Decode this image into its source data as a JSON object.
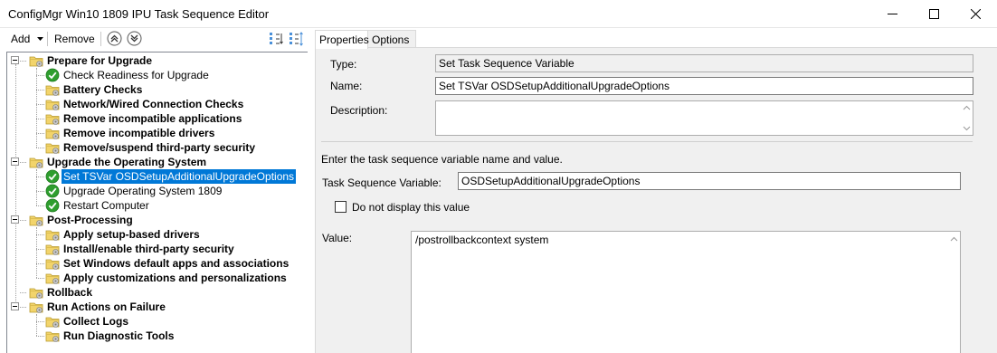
{
  "window": {
    "title": "ConfigMgr Win10 1809 IPU Task Sequence Editor",
    "controls": [
      "minimize-icon",
      "maximize-icon",
      "close-icon"
    ]
  },
  "toolbar": {
    "add_label": "Add",
    "remove_label": "Remove"
  },
  "tree": {
    "items": [
      {
        "label": "Prepare for Upgrade",
        "bold": true,
        "level": 0,
        "icon": "folder-icon"
      },
      {
        "label": "Check Readiness for Upgrade",
        "bold": false,
        "level": 1,
        "icon": "check-icon"
      },
      {
        "label": "Battery Checks",
        "bold": true,
        "level": 1,
        "icon": "folder-icon"
      },
      {
        "label": "Network/Wired Connection Checks",
        "bold": true,
        "level": 1,
        "icon": "folder-icon"
      },
      {
        "label": "Remove incompatible applications",
        "bold": true,
        "level": 1,
        "icon": "folder-icon"
      },
      {
        "label": "Remove incompatible drivers",
        "bold": true,
        "level": 1,
        "icon": "folder-icon"
      },
      {
        "label": "Remove/suspend third-party security",
        "bold": true,
        "level": 1,
        "icon": "folder-icon"
      },
      {
        "label": "Upgrade the Operating System",
        "bold": true,
        "level": 0,
        "icon": "folder-icon"
      },
      {
        "label": "Set TSVar OSDSetupAdditionalUpgradeOptions",
        "bold": false,
        "level": 1,
        "icon": "check-icon",
        "selected": true
      },
      {
        "label": "Upgrade Operating System 1809",
        "bold": false,
        "level": 1,
        "icon": "check-icon"
      },
      {
        "label": "Restart Computer",
        "bold": false,
        "level": 1,
        "icon": "check-icon"
      },
      {
        "label": "Post-Processing",
        "bold": true,
        "level": 0,
        "icon": "folder-icon"
      },
      {
        "label": "Apply setup-based drivers",
        "bold": true,
        "level": 1,
        "icon": "folder-icon"
      },
      {
        "label": "Install/enable third-party security",
        "bold": true,
        "level": 1,
        "icon": "folder-icon"
      },
      {
        "label": "Set Windows default apps and associations",
        "bold": true,
        "level": 1,
        "icon": "folder-icon"
      },
      {
        "label": "Apply customizations and personalizations",
        "bold": true,
        "level": 1,
        "icon": "folder-icon"
      },
      {
        "label": "Rollback",
        "bold": true,
        "level": 0,
        "icon": "folder-icon"
      },
      {
        "label": "Run Actions on Failure",
        "bold": true,
        "level": 0,
        "icon": "folder-icon"
      },
      {
        "label": "Collect Logs",
        "bold": true,
        "level": 1,
        "icon": "folder-icon"
      },
      {
        "label": "Run Diagnostic Tools",
        "bold": true,
        "level": 1,
        "icon": "folder-icon"
      }
    ]
  },
  "tabs": [
    {
      "label": "Properties",
      "active": true
    },
    {
      "label": "Options",
      "active": false
    }
  ],
  "properties": {
    "type_label": "Type:",
    "type_value": "Set Task Sequence Variable",
    "name_label": "Name:",
    "name_value": "Set TSVar OSDSetupAdditionalUpgradeOptions",
    "description_label": "Description:",
    "description_value": "",
    "instruction": "Enter the task sequence variable name and value.",
    "variable_label": "Task Sequence Variable:",
    "variable_value": "OSDSetupAdditionalUpgradeOptions",
    "hide_value_label": "Do not display this value",
    "hide_value_checked": false,
    "value_label": "Value:",
    "value_value": "/postrollbackcontext system"
  },
  "colors": {
    "selection": "#0078d7",
    "check_green": "#2e9e2e",
    "folder_yellow": "#f2d46b"
  }
}
